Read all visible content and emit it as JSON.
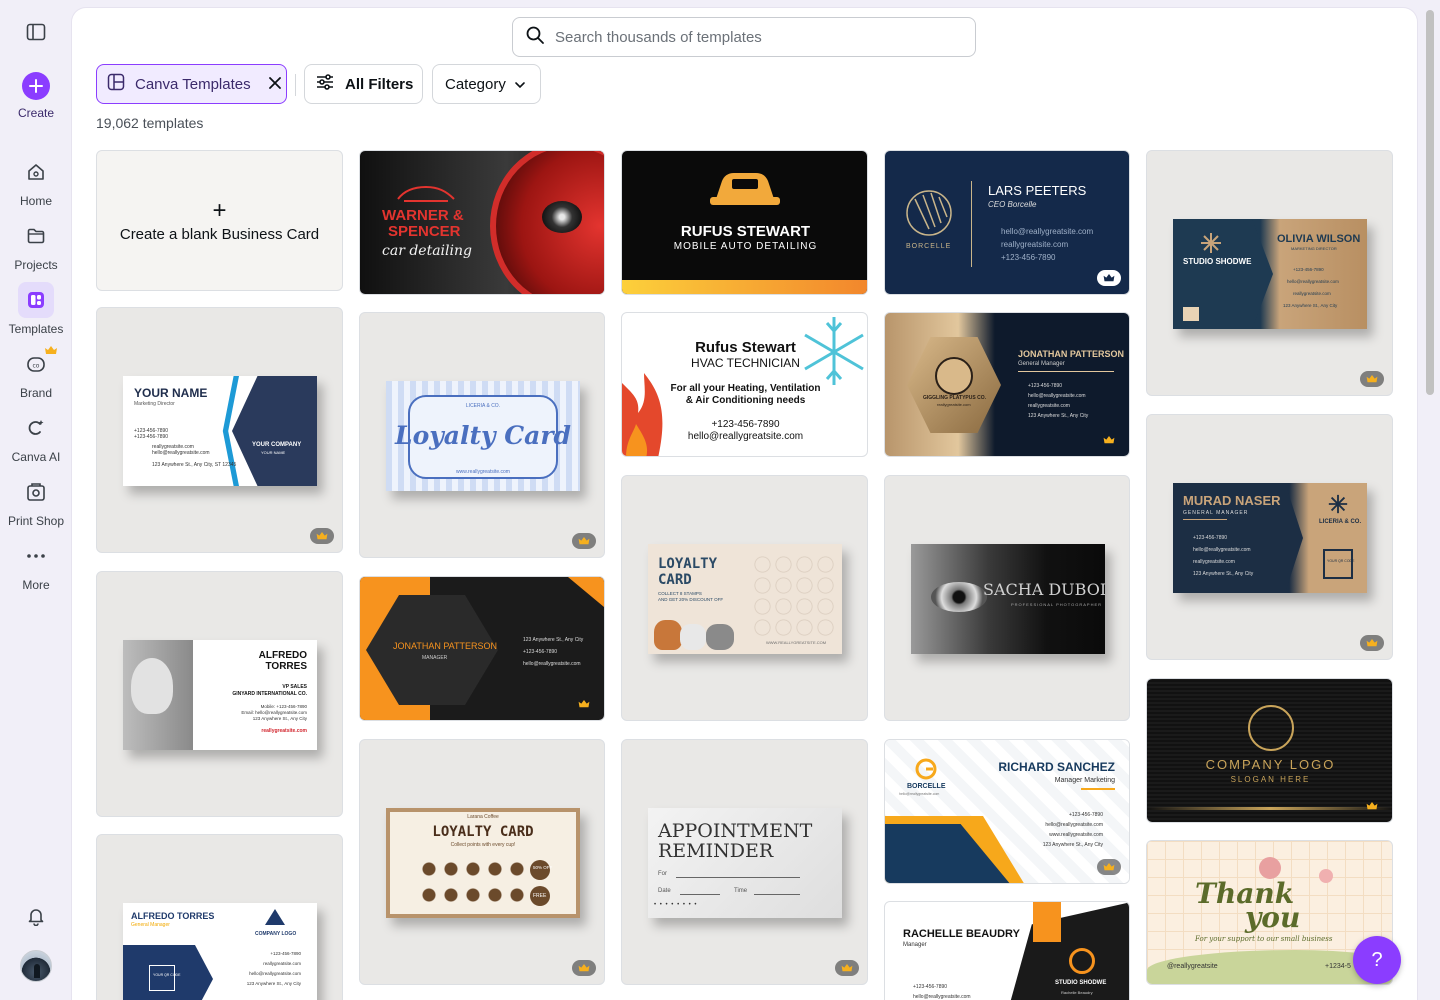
{
  "rail": {
    "create": "Create",
    "home": "Home",
    "projects": "Projects",
    "templates": "Templates",
    "brand": "Brand",
    "canva_ai": "Canva AI",
    "print_shop": "Print Shop",
    "more": "More"
  },
  "search": {
    "placeholder": "Search thousands of templates"
  },
  "filters": {
    "active_chip": "Canva Templates",
    "all_filters": "All Filters",
    "category": "Category"
  },
  "count": "19,062 templates",
  "blank_card": {
    "label": "Create a blank Business Card",
    "plus": "+"
  },
  "cards": {
    "warner": {
      "line1": "WARNER &",
      "line2": "SPENCER",
      "line3": "car detailing"
    },
    "rufus1": {
      "name": "RUFUS STEWART",
      "sub": "MOBILE AUTO DETAILING"
    },
    "lars": {
      "name": "LARS PEETERS",
      "role": "CEO Borcelle",
      "brand": "BORCELLE",
      "email": "hello@reallygreatsite.com",
      "web": "reallygreatsite.com",
      "phone": "+123-456-7890"
    },
    "olivia": {
      "name": "OLIVIA WILSON",
      "role": "MARKETING DIRECTOR",
      "brand": "STUDIO SHODWE",
      "phone": "+123-456-7890",
      "email": "hello@reallygreatsite.com",
      "web": "reallygreatsite.com",
      "addr": "123 Anywhere St., Any City"
    },
    "yourname": {
      "name": "YOUR NAME",
      "role": "Marketing Director",
      "company": "YOUR COMPANY",
      "company_sub": "YOUR NAME",
      "phone1": "+123-456-7890",
      "phone2": "+123-456-7890",
      "web": "reallygreatsite.com",
      "email": "hello@reallygreatsite.com",
      "addr": "123 Anywhere St., Any City, ST 12345"
    },
    "loyalty_blue": {
      "brand": "LICERIA & CO.",
      "title": "Loyalty Card",
      "web": "www.reallygreatsite.com"
    },
    "rufus2": {
      "name": "Rufus Stewart",
      "role": "HVAC TECHNICIAN",
      "line1": "For all your Heating, Ventilation",
      "line2": "& Air Conditioning needs",
      "phone": "+123-456-7890",
      "email": "hello@reallygreatsite.com"
    },
    "jonathan_gold": {
      "name": "JONATHAN PATTERSON",
      "role": "General Manager",
      "brand": "GIGGLING PLATYPUS CO.",
      "web_small": "reallygreatsite.com",
      "phone": "+123-456-7890",
      "email": "hello@reallygreatsite.com",
      "web": "reallygreatsite.com",
      "addr": "123 Anywhere St., Any City"
    },
    "murad": {
      "name": "MURAD NASER",
      "role": "GENERAL MANAGER",
      "brand": "LICERIA & CO.",
      "phone": "+123-456-7890",
      "email": "hello@reallygreatsite.com",
      "web": "reallygreatsite.com",
      "addr": "123 Anywhere St., Any City",
      "qr": "YOUR QR CODE"
    },
    "alfredo1": {
      "name1": "ALFREDO",
      "name2": "TORRES",
      "role": "VP SALES",
      "company": "GINYARD INTERNATIONAL CO.",
      "mobile": "Mobile: +123-456-7890",
      "email": "Email: hello@reallygreatsite.com",
      "addr": "123 Anywhere St., Any City",
      "web": "reallygreatsite.com"
    },
    "jonathan_orange": {
      "name": "JONATHAN PATTERSON",
      "role": "MANAGER",
      "addr": "123 Anywhere St., Any City",
      "phone": "+123-456-7890",
      "email": "hello@reallygreatsite.com"
    },
    "loyalty_dogs": {
      "line1": "LOYALTY",
      "line2": "CARD",
      "sub1": "COLLECT 8 STAMPS",
      "sub2": "AND GET 20% DISCOUNT OFF",
      "web": "WWW.REALLYGREATSITE.COM"
    },
    "sacha": {
      "name": "SACHA DUBOIS",
      "role": "PROFESSIONAL PHOTOGRAPHER"
    },
    "company_logo": {
      "title": "COMPANY LOGO",
      "sub": "SLOGAN HERE"
    },
    "loyalty_coffee": {
      "brand": "Larana Coffee",
      "title": "LOYALTY CARD",
      "sub": "Collect points with every cup!",
      "off": "50% OFF",
      "free": "FREE"
    },
    "appointment": {
      "line1": "APPOINTMENT",
      "line2": "REMINDER",
      "for": "For",
      "date": "Date",
      "time": "Time"
    },
    "richard": {
      "name": "RICHARD SANCHEZ",
      "role": "Manager Marketing",
      "brand": "BORCELLE",
      "brand_sub": "hello@reallygreatsite.com",
      "phone": "+123-456-7890",
      "email": "hello@reallygreatsite.com",
      "web": "www.reallygreatsite.com",
      "addr": "123 Anywhere St., Any City"
    },
    "alfredo2": {
      "name": "ALFREDO TORRES",
      "role": "General Manager",
      "logo": "COMPANY LOGO",
      "qr": "YOUR QR CODE",
      "phone": "+123-456-7890",
      "web": "reallygreatsite.com",
      "email": "hello@reallygreatsite.com",
      "addr": "123 Anywhere St., Any City"
    },
    "rachelle": {
      "name": "RACHELLE BEAUDRY",
      "role": "Manager",
      "brand": "STUDIO SHODWE",
      "brand_sub": "Rachelle Beaudry",
      "phone": "+123-456-7890",
      "email": "hello@reallygreatsite.com"
    },
    "thankyou": {
      "line1": "Thank",
      "line2": "you",
      "sub": "For your support to our small business",
      "handle": "@reallygreatsite",
      "phone": "+1234-5"
    }
  },
  "help": "?",
  "colors": {
    "accent": "#8b3dff",
    "chip_bg": "#f1ebff"
  }
}
